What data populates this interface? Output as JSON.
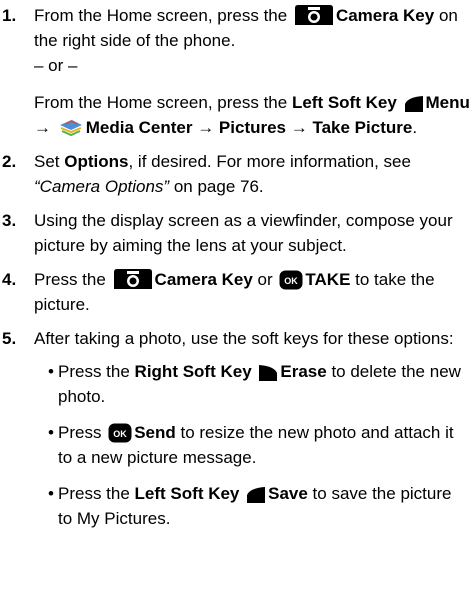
{
  "steps": [
    {
      "number": "1.",
      "line1_text_a": "From the Home screen, press the ",
      "line1_key": "Camera Key",
      "line1_text_b": " on the right side of the phone.",
      "or_text": "– or –",
      "alt_text_a": "From the Home screen, press the ",
      "alt_key": "Left Soft Key",
      "alt_menu": "Menu → ",
      "alt_media": "Media Center → Pictures → Take Picture",
      "alt_end": "."
    },
    {
      "number": "2.",
      "text_a": "Set ",
      "options": "Options",
      "text_b": ", if desired. For more information, see ",
      "ref": "“Camera Options”",
      "text_c": " on page 76."
    },
    {
      "number": "3.",
      "text": "Using the display screen as a viewfinder, compose your picture by aiming the lens at your subject."
    },
    {
      "number": "4.",
      "text_a": "Press the ",
      "camera_key": "Camera Key",
      "or": " or ",
      "take": "TAKE",
      "text_b": " to take the picture."
    },
    {
      "number": "5.",
      "text": "After taking a photo, use the soft keys for these options:",
      "bullets": [
        {
          "a": "Press the ",
          "b1": "Right Soft Key",
          "b2": "Erase",
          "c": " to delete the new photo."
        },
        {
          "a": "Press ",
          "b2": "Send",
          "c": " to resize the new photo and attach it to a new picture message."
        },
        {
          "a": "Press the ",
          "b1": "Left Soft Key",
          "b2": "Save",
          "c": " to save the picture to My Pictures."
        }
      ]
    }
  ],
  "icons": {
    "ok_label": "OK",
    "camera_key_icon": "camera-key-icon",
    "ok_key_icon": "ok-key-icon",
    "left_soft_key_icon": "left-soft-key-icon",
    "right_soft_key_icon": "right-soft-key-icon",
    "media_center_icon": "media-center-icon"
  }
}
